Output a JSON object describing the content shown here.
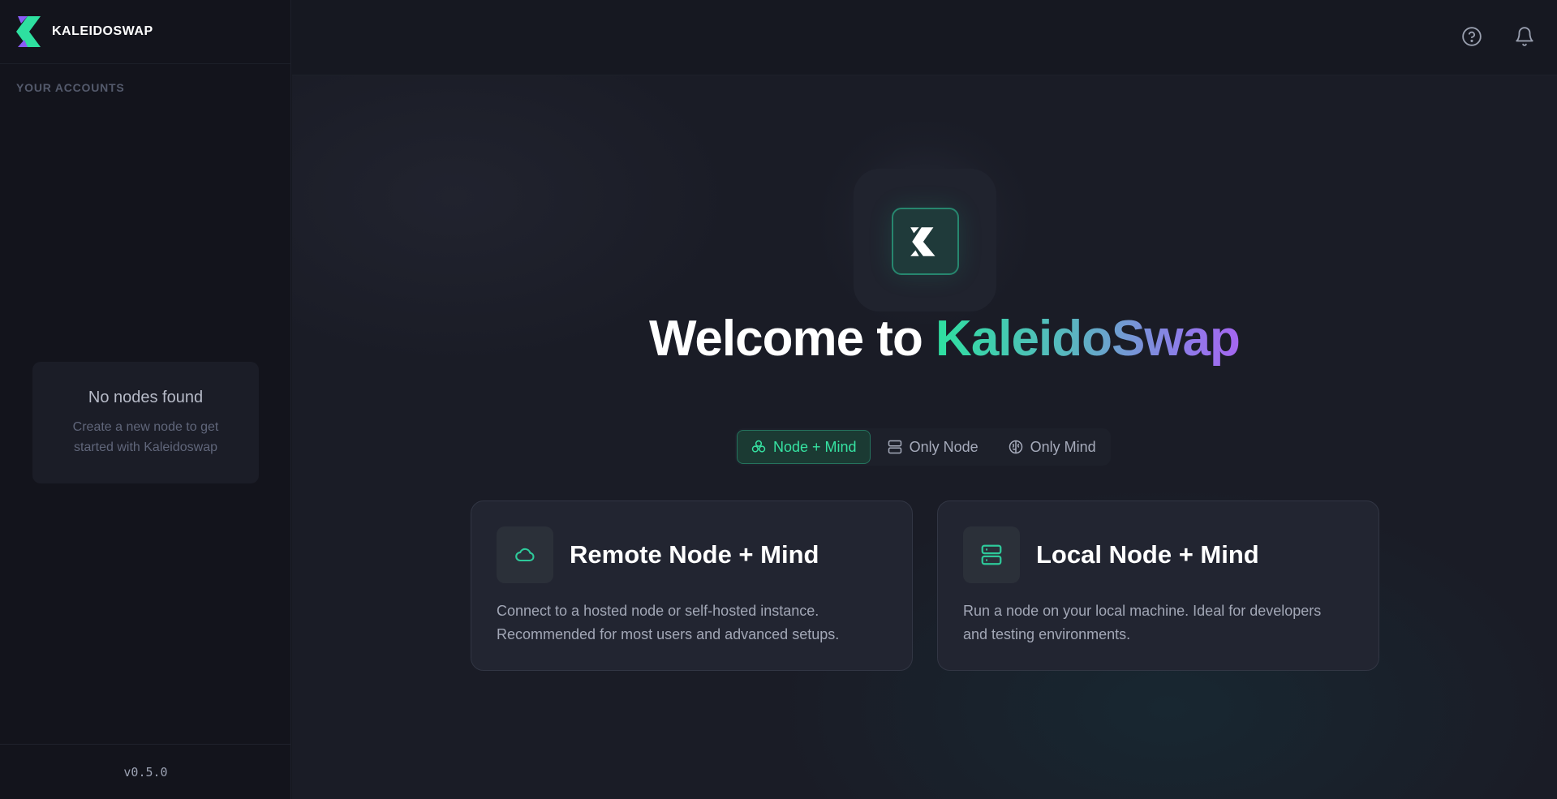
{
  "brand": {
    "name": "KALEIDOSWAP",
    "logo_icon": "kaleidoswap-logo-icon"
  },
  "sidebar": {
    "section_label": "YOUR ACCOUNTS",
    "empty_state": {
      "title": "No nodes found",
      "description": "Create a new node to get started with Kaleidoswap"
    },
    "version": "v0.5.0"
  },
  "topbar": {
    "help_icon": "help-circle-icon",
    "notifications_icon": "bell-icon"
  },
  "hero": {
    "welcome_prefix": "Welcome to",
    "welcome_brand": "KaleidoSwap"
  },
  "modes": [
    {
      "label": "Node + Mind",
      "icon": "nodes-cluster-icon",
      "active": true
    },
    {
      "label": "Only Node",
      "icon": "server-icon",
      "active": false
    },
    {
      "label": "Only Mind",
      "icon": "brain-icon",
      "active": false
    }
  ],
  "options": [
    {
      "title": "Remote Node + Mind",
      "icon": "cloud-icon",
      "description": "Connect to a hosted node or self-hosted instance. Recommended for most users and advanced setups."
    },
    {
      "title": "Local Node + Mind",
      "icon": "server-icon",
      "description": "Run a node on your local machine. Ideal for developers and testing environments."
    }
  ],
  "colors": {
    "accent_green": "#36e3a2",
    "accent_purple": "#a566f0",
    "background": "#1a1c26"
  }
}
